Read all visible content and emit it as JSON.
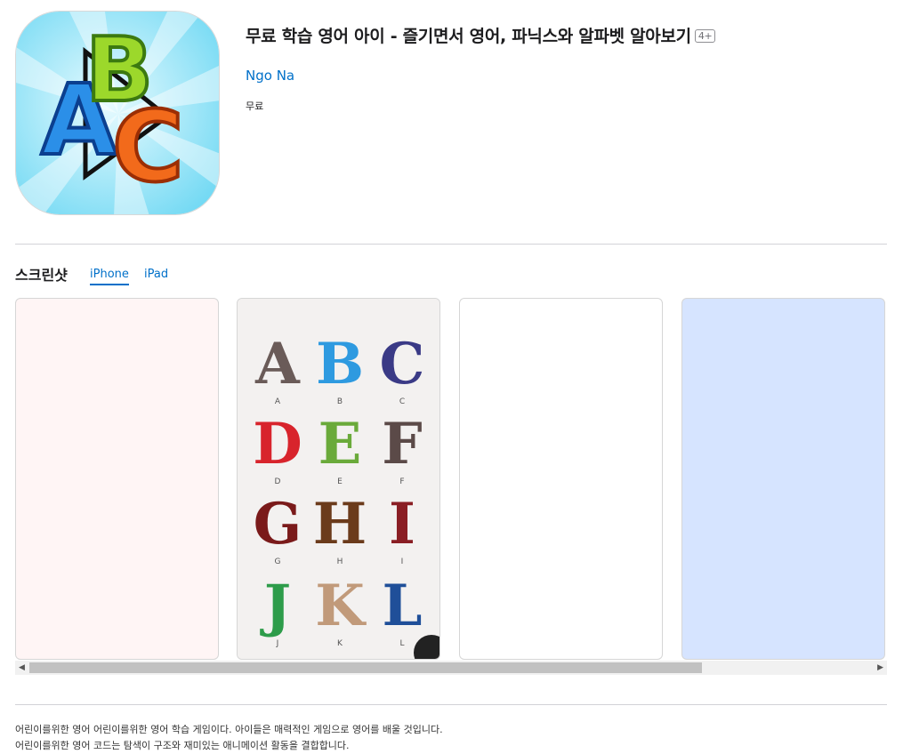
{
  "app": {
    "title": "무료 학습 영어 아이 - 즐기면서 영어, 파닉스와 알파벳 알아보기",
    "age_rating": "4+",
    "developer": "Ngo Na",
    "price": "무료"
  },
  "screenshots": {
    "title": "스크린샷",
    "tabs": [
      {
        "label": "iPhone",
        "active": true
      },
      {
        "label": "iPad",
        "active": false
      }
    ],
    "tiles": [
      {
        "bg": "#fff5f5"
      },
      {
        "bg": "#f3f1f0"
      },
      {
        "bg": "#ffffff"
      },
      {
        "bg": "#d6e4ff"
      }
    ],
    "alphabet_letters": [
      {
        "letter": "A",
        "caption": "A",
        "color": "#6a5b58"
      },
      {
        "letter": "B",
        "caption": "B",
        "color": "#2e9ae0"
      },
      {
        "letter": "C",
        "caption": "C",
        "color": "#3a3a86"
      },
      {
        "letter": "D",
        "caption": "D",
        "color": "#d8242c"
      },
      {
        "letter": "E",
        "caption": "E",
        "color": "#6aaa3a"
      },
      {
        "letter": "F",
        "caption": "F",
        "color": "#5b4a48"
      },
      {
        "letter": "G",
        "caption": "G",
        "color": "#7a1a1a"
      },
      {
        "letter": "H",
        "caption": "H",
        "color": "#6b3b1b"
      },
      {
        "letter": "I",
        "caption": "I",
        "color": "#8a1e24"
      },
      {
        "letter": "J",
        "caption": "J",
        "color": "#2d9c4a"
      },
      {
        "letter": "K",
        "caption": "K",
        "color": "#c19a7a"
      },
      {
        "letter": "L",
        "caption": "L",
        "color": "#1f4f99"
      }
    ]
  },
  "description": {
    "line1": "어린이를위한 영어 어린이를위한 영어 학습 게임이다. 아이들은 매력적인 게임으로 영어를 배울 것입니다.",
    "line2": "어린이를위한 영어 코드는 탐색이 구조와 재미있는 애니메이션 활동을 결합합니다."
  },
  "colors": {
    "link": "#0070c9",
    "icon_bg": "#7fe0f7",
    "icon_letter_a": "#2b8fe8",
    "icon_letter_b": "#9cd82b",
    "icon_letter_c": "#f26a1b"
  }
}
